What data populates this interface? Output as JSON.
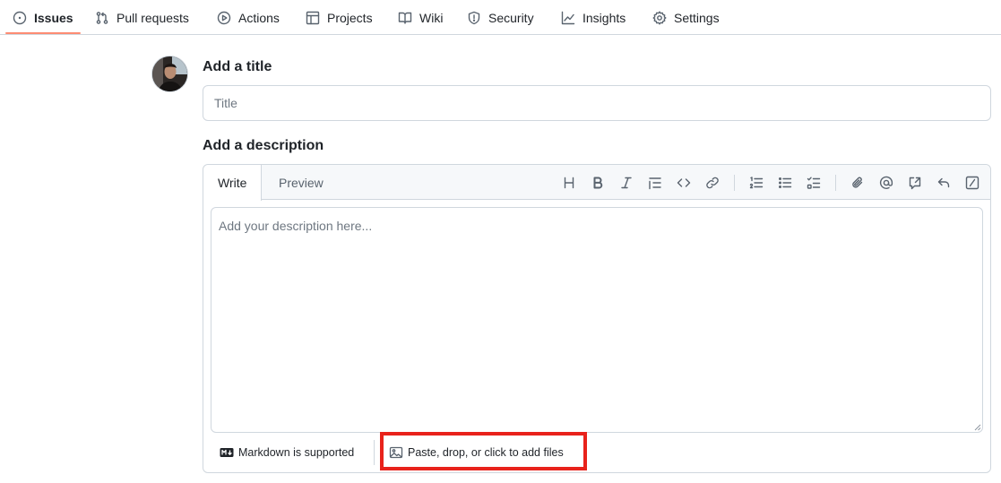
{
  "nav": {
    "items": [
      {
        "label": "Issues",
        "icon": "issue-opened-icon",
        "selected": true
      },
      {
        "label": "Pull requests",
        "icon": "git-pull-request-icon",
        "selected": false
      },
      {
        "label": "Actions",
        "icon": "play-icon",
        "selected": false
      },
      {
        "label": "Projects",
        "icon": "table-icon",
        "selected": false
      },
      {
        "label": "Wiki",
        "icon": "book-icon",
        "selected": false
      },
      {
        "label": "Security",
        "icon": "shield-icon",
        "selected": false
      },
      {
        "label": "Insights",
        "icon": "graph-icon",
        "selected": false
      },
      {
        "label": "Settings",
        "icon": "gear-icon",
        "selected": false
      }
    ],
    "underline_color": "#fd8c73"
  },
  "form": {
    "title_label": "Add a title",
    "title_placeholder": "Title",
    "title_value": "",
    "description_label": "Add a description",
    "description_placeholder": "Add your description here...",
    "description_value": ""
  },
  "editor": {
    "tabs": [
      {
        "label": "Write",
        "active": true
      },
      {
        "label": "Preview",
        "active": false
      }
    ],
    "toolbar_icons": [
      "heading-icon",
      "bold-icon",
      "italic-icon",
      "quote-icon",
      "code-icon",
      "link-icon",
      "ordered-list-icon",
      "unordered-list-icon",
      "task-list-icon",
      "paperclip-icon",
      "mention-icon",
      "cross-reference-icon",
      "reply-icon",
      "slash-command-icon"
    ],
    "footer": {
      "markdown_label": "Markdown is supported",
      "attach_label": "Paste, drop, or click to add files"
    }
  },
  "colors": {
    "border": "#d0d7de",
    "muted_text": "#59636e",
    "highlight": "#e8221b"
  }
}
